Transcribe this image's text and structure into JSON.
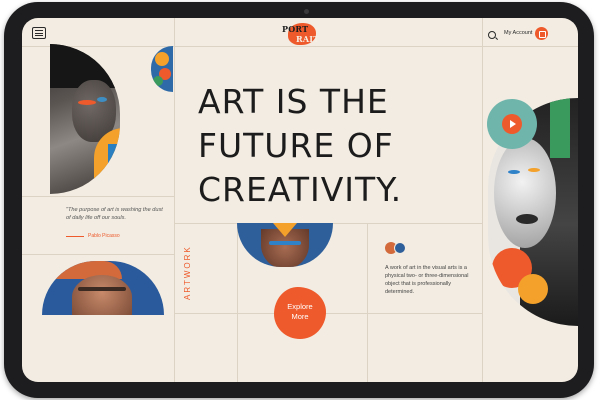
{
  "header": {
    "logo_line1": "PORT",
    "logo_line2": "RAIT",
    "account_label": "My Account"
  },
  "hero": {
    "line1": "ART IS THE",
    "line2": "FUTURE OF",
    "line3": "CREATIVITY."
  },
  "quote": {
    "text": "\"The purpose of art is washing the dust of daily life off our souls.",
    "author": "Pablo Picasso"
  },
  "artwork_label": "ARTWORK",
  "description": "A work of art in the visual arts is a physical two- or three-dimensional object that is professionally determined.",
  "explore": {
    "line1": "Explore",
    "line2": "More"
  },
  "colors": {
    "accent": "#ee5a2b",
    "background": "#f2ece2",
    "teal": "#6fb5ab",
    "blue": "#2f82c8",
    "yellow": "#f3a12a"
  },
  "icons": [
    "menu-icon",
    "search-icon",
    "bag-icon",
    "play-icon"
  ]
}
